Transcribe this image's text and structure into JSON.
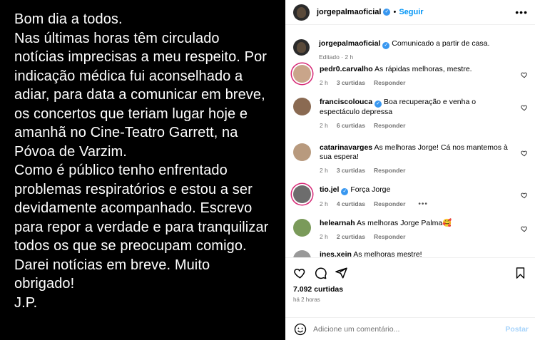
{
  "image_text": [
    "Bom dia a todos.",
    "Nas últimas horas têm circulado",
    "notícias imprecisas a meu respeito. Por",
    "indicação médica fui aconselhado a",
    "adiar, para data a comunicar em breve,",
    "os concertos que teriam lugar hoje e",
    "amanhã no Cine-Teatro Garrett, na",
    "Póvoa de Varzim.",
    "Como é público tenho enfrentado",
    "problemas respiratórios e estou a ser",
    "devidamente acompanhado. Escrevo",
    "para repor a verdade e para tranquilizar",
    "todos os que se preocupam comigo.",
    "Darei notícias em breve. Muito",
    "obrigado!",
    "J.P."
  ],
  "header": {
    "username": "jorgepalmaoficial",
    "separator": "•",
    "follow_label": "Seguir",
    "more_label": "•••"
  },
  "caption": {
    "username": "jorgepalmaoficial",
    "text": "Comunicado a partir de casa.",
    "meta": "Editado · 2 h"
  },
  "comments": [
    {
      "username": "pedr0.carvalho",
      "text": "As rápidas melhoras, mestre.",
      "time": "2 h",
      "likes": "3 curtidas",
      "reply": "Responder",
      "verified": false,
      "avatar_color": "#c9a58a"
    },
    {
      "username": "franciscolouca",
      "text": "Boa recuperação e venha o espectáculo depressa",
      "time": "2 h",
      "likes": "6 curtidas",
      "reply": "Responder",
      "verified": true,
      "avatar_color": "#8a6a52"
    },
    {
      "username": "catarinavarges",
      "text": "As melhoras Jorge! Cá nos mantemos à sua espera!",
      "time": "2 h",
      "likes": "3 curtidas",
      "reply": "Responder",
      "verified": false,
      "avatar_color": "#b89a7e"
    },
    {
      "username": "tio.jel",
      "text": "Força Jorge",
      "time": "2 h",
      "likes": "4 curtidas",
      "reply": "Responder",
      "verified": true,
      "avatar_color": "#6d6d6d",
      "more": "•••"
    },
    {
      "username": "helearnah",
      "text": "As melhoras Jorge Palma",
      "emoji": "🥰",
      "time": "2 h",
      "likes": "2 curtidas",
      "reply": "Responder",
      "verified": false,
      "avatar_color": "#7a9a5a"
    },
    {
      "username": "ines.xein",
      "text": "As melhoras mestre!",
      "time": "",
      "likes": "",
      "reply": "",
      "verified": false,
      "avatar_color": "#999999"
    }
  ],
  "engagement": {
    "likes": "7.092 curtidas",
    "time": "há 2 horas"
  },
  "add_comment": {
    "placeholder": "Adicione um comentário...",
    "post_label": "Postar"
  },
  "icons": {
    "like": "heart-icon",
    "comment": "comment-icon",
    "share": "share-icon",
    "save": "bookmark-icon",
    "emoji": "emoji-icon"
  }
}
